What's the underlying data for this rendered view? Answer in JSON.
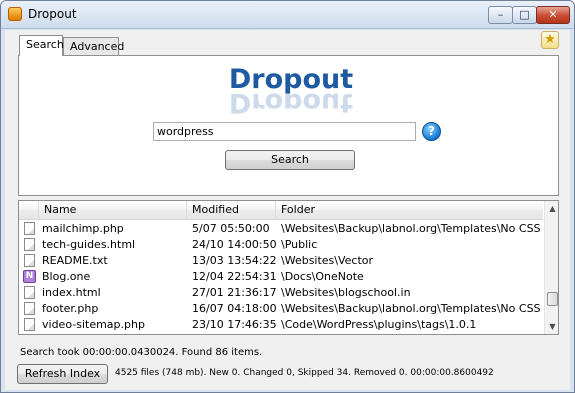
{
  "window": {
    "title": "Dropout",
    "minimize": "–",
    "maximize": "□",
    "close": "✕"
  },
  "tabs": [
    {
      "label": "Search",
      "active": true
    },
    {
      "label": "Advanced",
      "active": false
    }
  ],
  "logo": {
    "text": "Dropout",
    "color": "#1e5aa0"
  },
  "search": {
    "value": "wordpress",
    "help_glyph": "?",
    "button_label": "Search"
  },
  "results": {
    "columns": [
      "Name",
      "Modified",
      "Folder"
    ],
    "rows": [
      {
        "icon": "file-icon",
        "name": "mailchimp.php",
        "modified": "5/07 05:50:00",
        "folder": "\\Websites\\Backup\\labnol.org\\Templates\\No CSS S..."
      },
      {
        "icon": "file-icon",
        "name": "tech-guides.html",
        "modified": "24/10 14:00:50",
        "folder": "\\Public"
      },
      {
        "icon": "file-icon",
        "name": "README.txt",
        "modified": "13/03 13:54:22",
        "folder": "\\Websites\\Vector"
      },
      {
        "icon": "onenote-icon",
        "name": "Blog.one",
        "modified": "12/04 22:54:31",
        "folder": "\\Docs\\OneNote"
      },
      {
        "icon": "file-icon",
        "name": "index.html",
        "modified": "27/01 21:36:17",
        "folder": "\\Websites\\blogschool.in"
      },
      {
        "icon": "file-icon",
        "name": "footer.php",
        "modified": "16/07 04:18:00",
        "folder": "\\Websites\\Backup\\labnol.org\\Templates\\No CSS S..."
      },
      {
        "icon": "file-icon",
        "name": "video-sitemap.php",
        "modified": "23/10 17:46:35",
        "folder": "\\Code\\WordPress\\plugins\\tags\\1.0.1"
      }
    ]
  },
  "status": {
    "search_summary": "Search took 00:00:00.0430024. Found 86 items.",
    "refresh_label": "Refresh Index",
    "index_summary": "4525 files (748 mb). New 0. Changed 0, Skipped 34. Removed 0. 00:00:00.8600492"
  }
}
